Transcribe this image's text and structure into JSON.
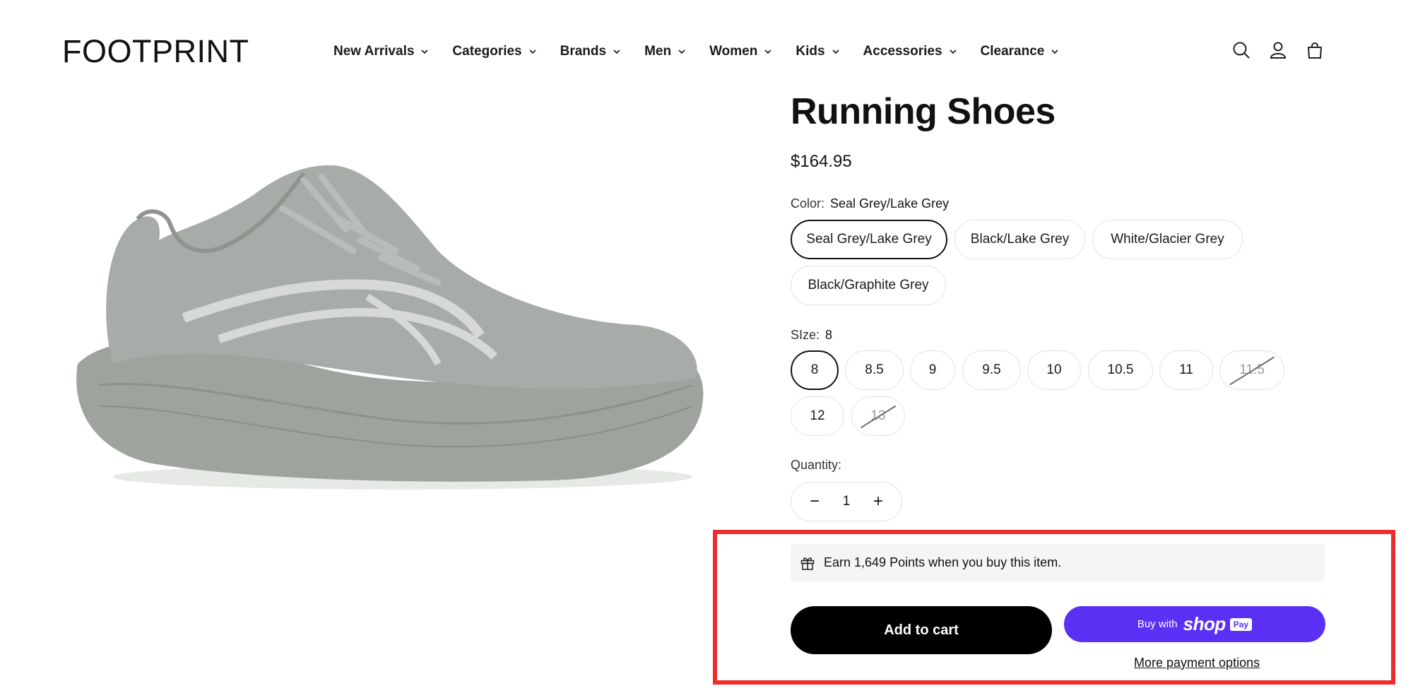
{
  "header": {
    "logo": "FOOTPRINT",
    "nav": [
      {
        "label": "New Arrivals"
      },
      {
        "label": "Categories"
      },
      {
        "label": "Brands"
      },
      {
        "label": "Men"
      },
      {
        "label": "Women"
      },
      {
        "label": "Kids"
      },
      {
        "label": "Accessories"
      },
      {
        "label": "Clearance"
      }
    ],
    "icons": [
      "search-icon",
      "account-icon",
      "cart-icon"
    ]
  },
  "product": {
    "title": "Running Shoes",
    "price": "$164.95",
    "image": {
      "icon": "running-shoe-image",
      "color": "#a6aaa6"
    },
    "color": {
      "label": "Color:",
      "value": "Seal Grey/Lake Grey",
      "options": [
        {
          "label": "Seal Grey/Lake Grey",
          "selected": true
        },
        {
          "label": "Black/Lake Grey",
          "selected": false
        },
        {
          "label": "White/Glacier Grey",
          "selected": false
        },
        {
          "label": "Black/Graphite Grey",
          "selected": false
        }
      ]
    },
    "size": {
      "label": "SIze:",
      "value": "8",
      "options": [
        {
          "label": "8",
          "selected": true,
          "available": true
        },
        {
          "label": "8.5",
          "selected": false,
          "available": true
        },
        {
          "label": "9",
          "selected": false,
          "available": true
        },
        {
          "label": "9.5",
          "selected": false,
          "available": true
        },
        {
          "label": "10",
          "selected": false,
          "available": true
        },
        {
          "label": "10.5",
          "selected": false,
          "available": true
        },
        {
          "label": "11",
          "selected": false,
          "available": true
        },
        {
          "label": "11.5",
          "selected": false,
          "available": false
        },
        {
          "label": "12",
          "selected": false,
          "available": true
        },
        {
          "label": "13",
          "selected": false,
          "available": false
        }
      ]
    },
    "quantity": {
      "label": "Quantity:",
      "value": "1",
      "minus": "−",
      "plus": "+"
    }
  },
  "purchase": {
    "points_text": "Earn 1,649 Points when you buy this item.",
    "add_to_cart": "Add to cart",
    "shop_pay": {
      "prefix": "Buy with",
      "brand": "shop",
      "badge": "Pay"
    },
    "more_options": "More payment options",
    "highlight_color": "#ef2b2b",
    "shop_pay_color": "#5a31f4"
  }
}
